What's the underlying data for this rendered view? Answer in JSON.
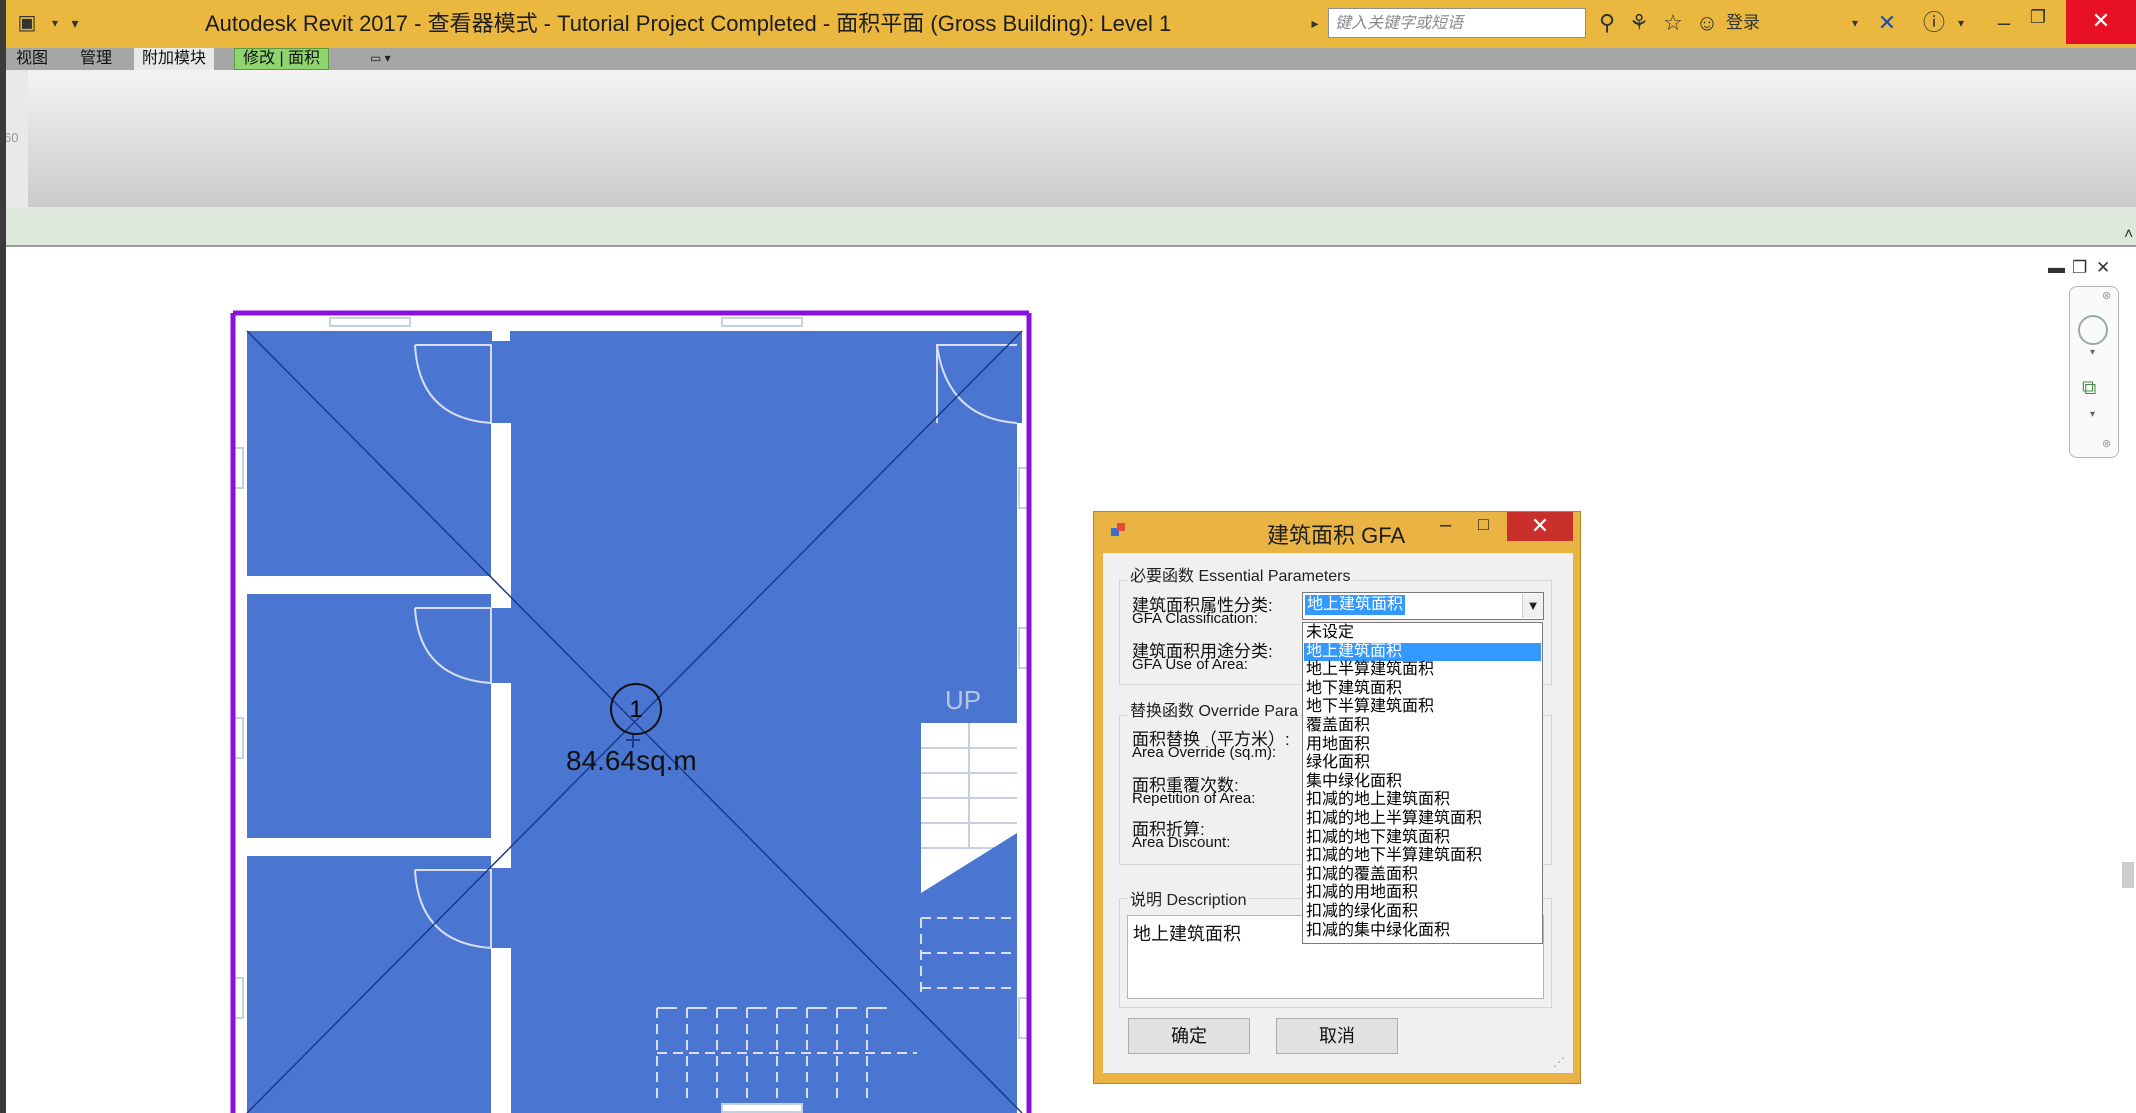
{
  "window": {
    "title": "Autodesk Revit 2017 - 查看器模式 -    Tutorial Project Completed - 面积平面 (Gross Building): Level 1",
    "search_placeholder": "键入关键字或短语",
    "login_label": "登录",
    "close_glyph": "✕",
    "minimize_glyph": "–",
    "restore_glyph": "❐"
  },
  "ribbon": {
    "tabs": [
      "视图",
      "管理",
      "附加模块",
      "修改 | 面积"
    ],
    "ruler_fragment": "60"
  },
  "drawing": {
    "area_tag_number": "1",
    "area_value": "84.64sq.m",
    "stair_label": "UP",
    "fill_color": "#4a76d2",
    "boundary_color": "#8b10e0"
  },
  "dialog": {
    "title": "建筑面积 GFA",
    "essential_group": "必要函数 Essential Parameters",
    "classification_cn": "建筑面积属性分类:",
    "classification_en": "GFA Classification:",
    "use_cn": "建筑面积用途分类:",
    "use_en": "GFA Use of Area:",
    "override_group": "替换函数 Override Para",
    "area_override_cn": "面积替换（平方米）:",
    "area_override_en": "Area Override (sq.m):",
    "repetition_cn": "面积重覆次数:",
    "repetition_en": "Repetition of Area:",
    "discount_cn": "面积折算:",
    "discount_en": "Area Discount:",
    "description_group": "说明 Description",
    "description_text": "地上建筑面积",
    "combo_value": "地上建筑面积",
    "dropdown_options": [
      "未设定",
      "地上建筑面积",
      "地上半算建筑面积",
      "地下建筑面积",
      "地下半算建筑面积",
      "覆盖面积",
      "用地面积",
      "绿化面积",
      "集中绿化面积",
      "扣减的地上建筑面积",
      "扣减的地上半算建筑面积",
      "扣减的地下建筑面积",
      "扣减的地下半算建筑面积",
      "扣减的覆盖面积",
      "扣减的用地面积",
      "扣减的绿化面积",
      "扣减的集中绿化面积"
    ],
    "selected_index": 1,
    "ok_label": "确定",
    "cancel_label": "取消"
  }
}
